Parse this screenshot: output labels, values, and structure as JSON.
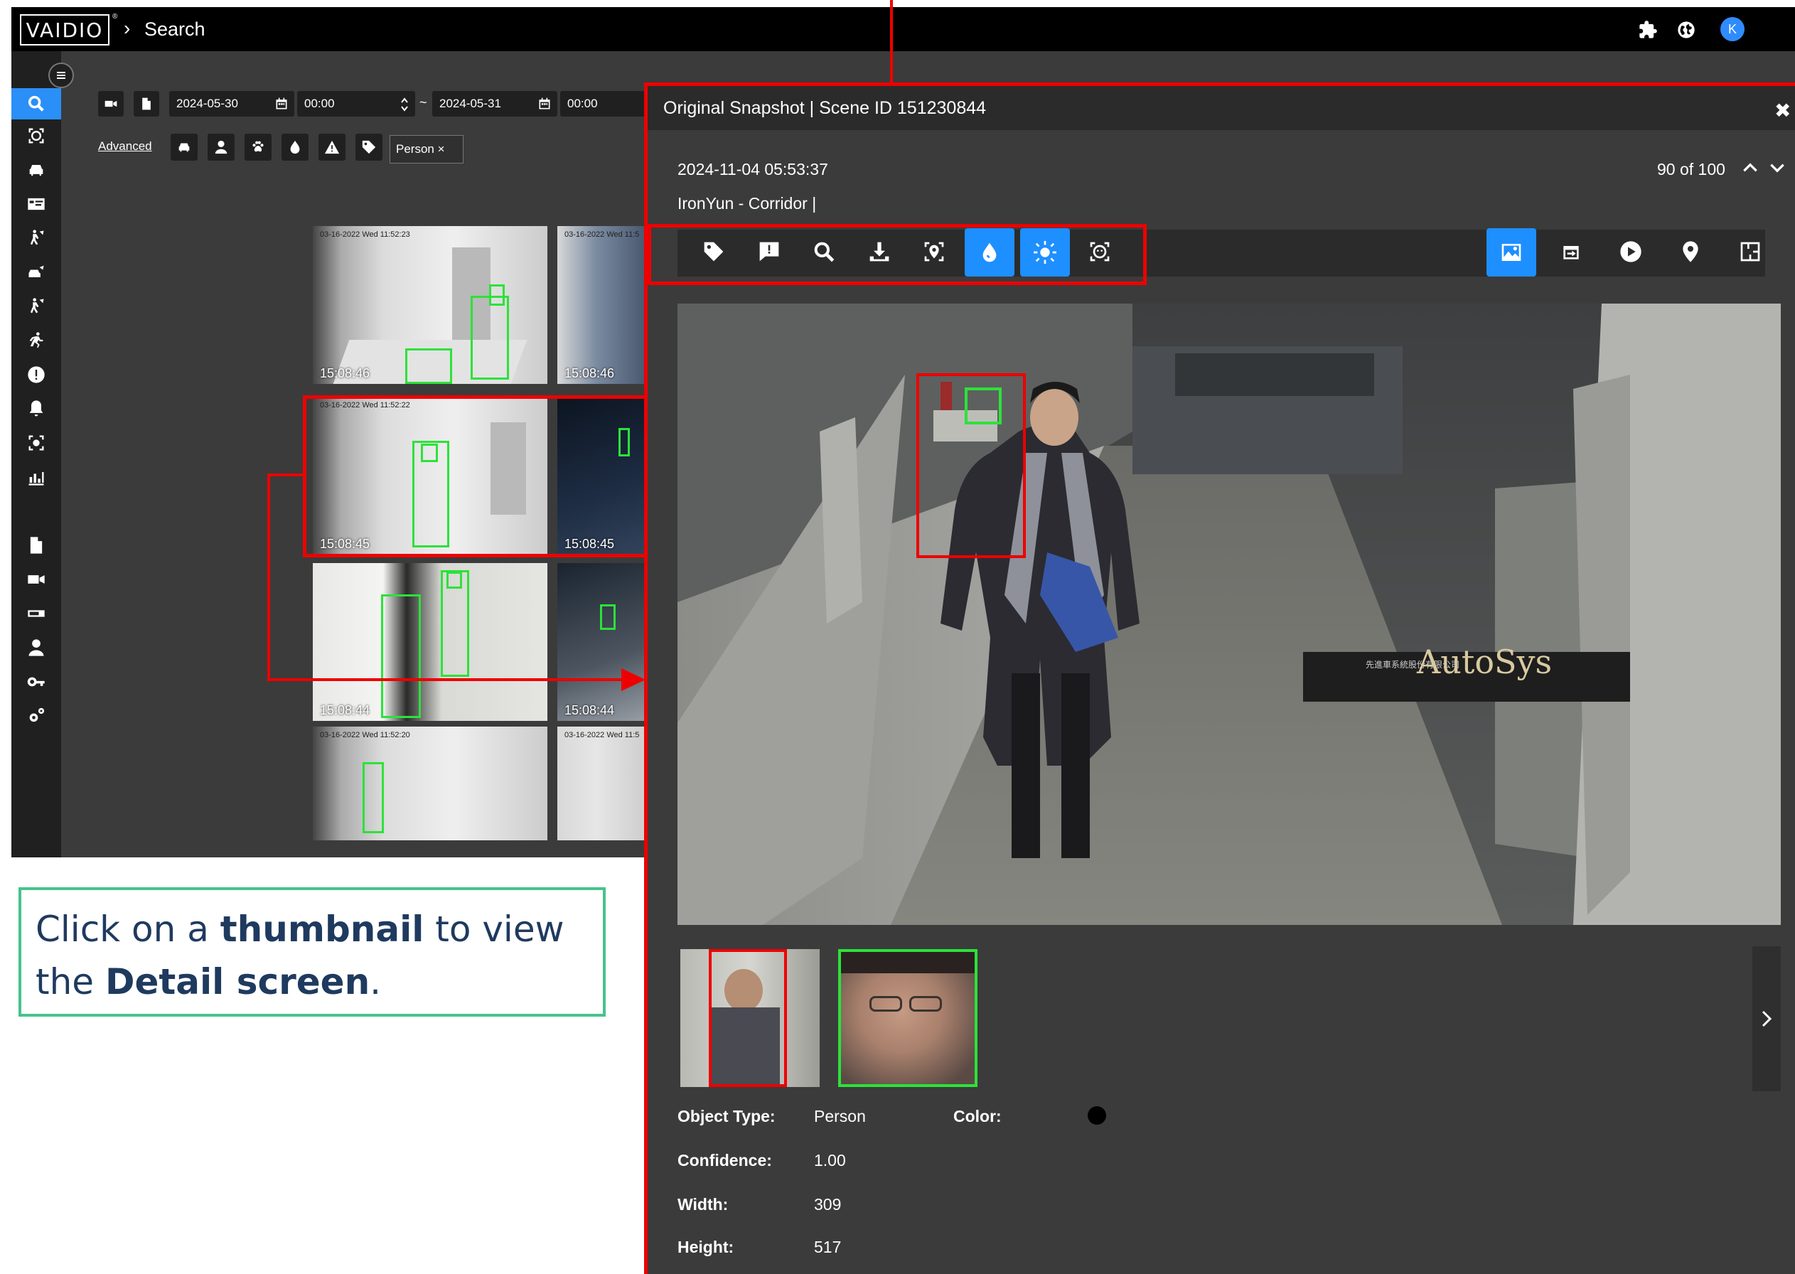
{
  "app": {
    "logo": "VAIDIO",
    "logo_mark": "®",
    "breadcrumb": "Search",
    "user_initial": "K"
  },
  "filters": {
    "start_date": "2024-05-30",
    "start_time": "00:00",
    "range_sep": "~",
    "end_date": "2024-05-31",
    "end_time": "00:00",
    "advanced_label": "Advanced",
    "tag_chip": "Person ×"
  },
  "results": [
    {
      "time": "15:08:46",
      "stamp": "03-16-2022 Wed 11:52:23"
    },
    {
      "time": "15:08:46",
      "stamp": "03-16-2022 Wed 11:5"
    },
    {
      "time": "15:08:45",
      "stamp": "03-16-2022 Wed 11:52:22"
    },
    {
      "time": "15:08:45",
      "stamp": ""
    },
    {
      "time": "15:08:44",
      "stamp": ""
    },
    {
      "time": "15:08:44",
      "stamp": ""
    },
    {
      "time": "",
      "stamp": "03-16-2022 Wed 11:52:20"
    },
    {
      "time": "",
      "stamp": "03-16-2022 Wed 11:5"
    }
  ],
  "callout": {
    "pre": "Click on a ",
    "b1": "thumbnail",
    "mid": " to view the ",
    "b2": "Detail screen",
    "post": "."
  },
  "detail": {
    "title": "Original Snapshot | Scene ID  151230844",
    "datetime": "2024-11-04 05:53:37",
    "location": "IronYun - Corridor |",
    "counter": "90 of 100",
    "scene_sign": "AutoSys",
    "scene_sign_sub": "先進車系統股份有限公司",
    "attributes": {
      "object_type_label": "Object Type:",
      "object_type": "Person",
      "color_label": "Color:",
      "confidence_label": "Confidence:",
      "confidence": "1.00",
      "width_label": "Width:",
      "width": "309",
      "height_label": "Height:",
      "height": "517"
    }
  },
  "colors": {
    "accent": "#1e8fff",
    "highlight": "#e00000",
    "detection": "#2ce23a",
    "callout_border": "#46c38c",
    "callout_text": "#1f3a5f"
  }
}
